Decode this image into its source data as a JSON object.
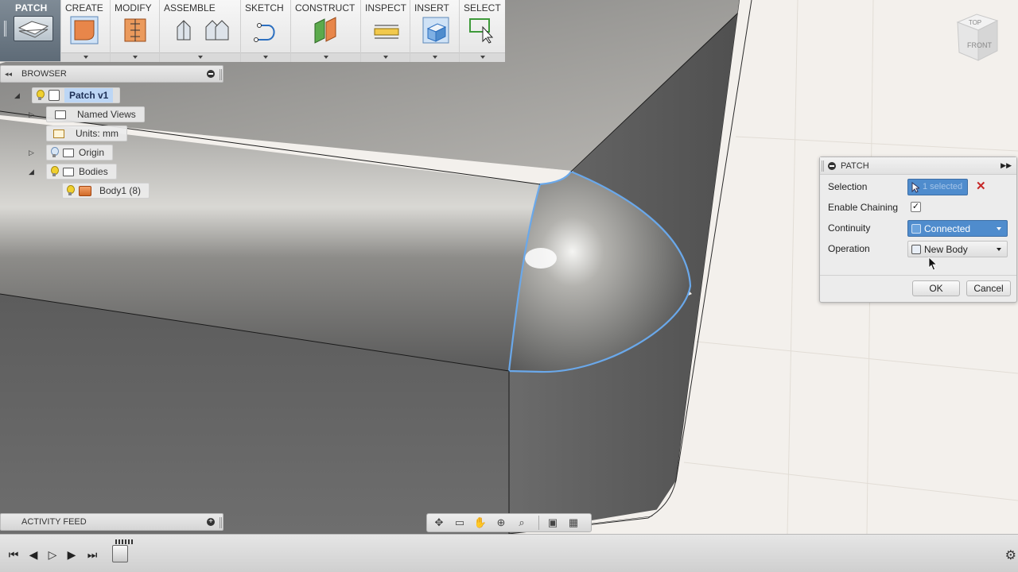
{
  "toolbar": {
    "workspace": {
      "label": "PATCH",
      "icon": "patch-workspace-icon"
    },
    "groups": [
      {
        "label": "CREATE",
        "icons": [
          "create-patch-icon"
        ]
      },
      {
        "label": "MODIFY",
        "icons": [
          "modify-icon"
        ]
      },
      {
        "label": "ASSEMBLE",
        "icons": [
          "joint-icon",
          "as-built-joint-icon"
        ]
      },
      {
        "label": "SKETCH",
        "icons": [
          "sketch-curve-icon"
        ]
      },
      {
        "label": "CONSTRUCT",
        "icons": [
          "offset-plane-icon"
        ]
      },
      {
        "label": "INSPECT",
        "icons": [
          "measure-icon"
        ]
      },
      {
        "label": "INSERT",
        "icons": [
          "insert-body-icon"
        ]
      },
      {
        "label": "SELECT",
        "icons": [
          "select-box-icon"
        ]
      }
    ]
  },
  "browser": {
    "title": "BROWSER",
    "items": [
      {
        "label": "Patch v1",
        "selected": true
      },
      {
        "label": "Named Views"
      },
      {
        "label": "Units: mm"
      },
      {
        "label": "Origin"
      },
      {
        "label": "Bodies"
      },
      {
        "label": "Body1 (8)"
      }
    ]
  },
  "activity_feed": {
    "title": "ACTIVITY FEED"
  },
  "viewcube": {
    "top": "TOP",
    "front": "FRONT"
  },
  "dialog": {
    "title": "PATCH",
    "selection_label": "Selection",
    "selection_value": "1 selected",
    "chaining_label": "Enable Chaining",
    "chaining_checked": true,
    "chaining_mark": "✓",
    "continuity_label": "Continuity",
    "continuity_value": "Connected",
    "operation_label": "Operation",
    "operation_value": "New Body",
    "ok": "OK",
    "cancel": "Cancel"
  },
  "colors": {
    "accent_blue": "#4f8ccd",
    "selection_edge": "#6aa8ea",
    "clear_red": "#c62828",
    "grid_bg": "#f3f0ec"
  }
}
